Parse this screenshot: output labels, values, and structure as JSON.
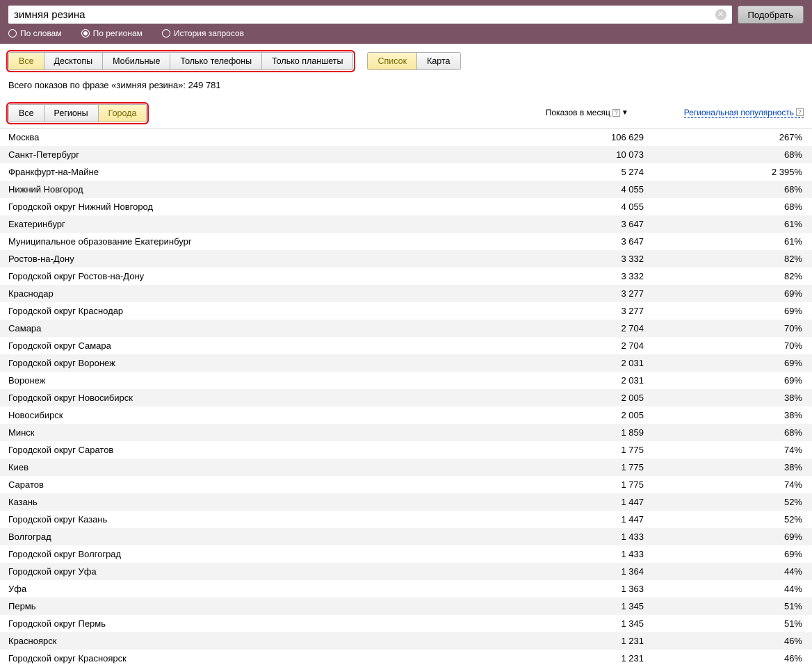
{
  "search": {
    "value": "зимняя резина",
    "submit_label": "Подобрать"
  },
  "radios": [
    {
      "label": "По словам",
      "selected": false
    },
    {
      "label": "По регионам",
      "selected": true
    },
    {
      "label": "История запросов",
      "selected": false
    }
  ],
  "device_tabs": [
    "Все",
    "Десктопы",
    "Мобильные",
    "Только телефоны",
    "Только планшеты"
  ],
  "device_active": 0,
  "view_tabs": [
    "Список",
    "Карта"
  ],
  "view_active": 0,
  "summary": "Всего показов по фразе «зимняя резина»: 249 781",
  "region_tabs": [
    "Все",
    "Регионы",
    "Города"
  ],
  "region_active": 2,
  "columns": {
    "views": "Показов в месяц",
    "popularity": "Региональная популярность"
  },
  "rows": [
    {
      "city": "Москва",
      "views": "106 629",
      "pop": "267%"
    },
    {
      "city": "Санкт-Петербург",
      "views": "10 073",
      "pop": "68%"
    },
    {
      "city": "Франкфурт-на-Майне",
      "views": "5 274",
      "pop": "2 395%"
    },
    {
      "city": "Нижний Новгород",
      "views": "4 055",
      "pop": "68%"
    },
    {
      "city": "Городской округ Нижний Новгород",
      "views": "4 055",
      "pop": "68%"
    },
    {
      "city": "Екатеринбург",
      "views": "3 647",
      "pop": "61%"
    },
    {
      "city": "Муниципальное образование Екатеринбург",
      "views": "3 647",
      "pop": "61%"
    },
    {
      "city": "Ростов-на-Дону",
      "views": "3 332",
      "pop": "82%"
    },
    {
      "city": "Городской округ Ростов-на-Дону",
      "views": "3 332",
      "pop": "82%"
    },
    {
      "city": "Краснодар",
      "views": "3 277",
      "pop": "69%"
    },
    {
      "city": "Городской округ Краснодар",
      "views": "3 277",
      "pop": "69%"
    },
    {
      "city": "Самара",
      "views": "2 704",
      "pop": "70%"
    },
    {
      "city": "Городской округ Самара",
      "views": "2 704",
      "pop": "70%"
    },
    {
      "city": "Городской округ Воронеж",
      "views": "2 031",
      "pop": "69%"
    },
    {
      "city": "Воронеж",
      "views": "2 031",
      "pop": "69%"
    },
    {
      "city": "Городской округ Новосибирск",
      "views": "2 005",
      "pop": "38%"
    },
    {
      "city": "Новосибирск",
      "views": "2 005",
      "pop": "38%"
    },
    {
      "city": "Минск",
      "views": "1 859",
      "pop": "68%"
    },
    {
      "city": "Городской округ Саратов",
      "views": "1 775",
      "pop": "74%"
    },
    {
      "city": "Киев",
      "views": "1 775",
      "pop": "38%"
    },
    {
      "city": "Саратов",
      "views": "1 775",
      "pop": "74%"
    },
    {
      "city": "Казань",
      "views": "1 447",
      "pop": "52%"
    },
    {
      "city": "Городской округ Казань",
      "views": "1 447",
      "pop": "52%"
    },
    {
      "city": "Волгоград",
      "views": "1 433",
      "pop": "69%"
    },
    {
      "city": "Городской округ Волгоград",
      "views": "1 433",
      "pop": "69%"
    },
    {
      "city": "Городской округ Уфа",
      "views": "1 364",
      "pop": "44%"
    },
    {
      "city": "Уфа",
      "views": "1 363",
      "pop": "44%"
    },
    {
      "city": "Пермь",
      "views": "1 345",
      "pop": "51%"
    },
    {
      "city": "Городской округ Пермь",
      "views": "1 345",
      "pop": "51%"
    },
    {
      "city": "Красноярск",
      "views": "1 231",
      "pop": "46%"
    },
    {
      "city": "Городской округ Красноярск",
      "views": "1 231",
      "pop": "46%"
    }
  ]
}
